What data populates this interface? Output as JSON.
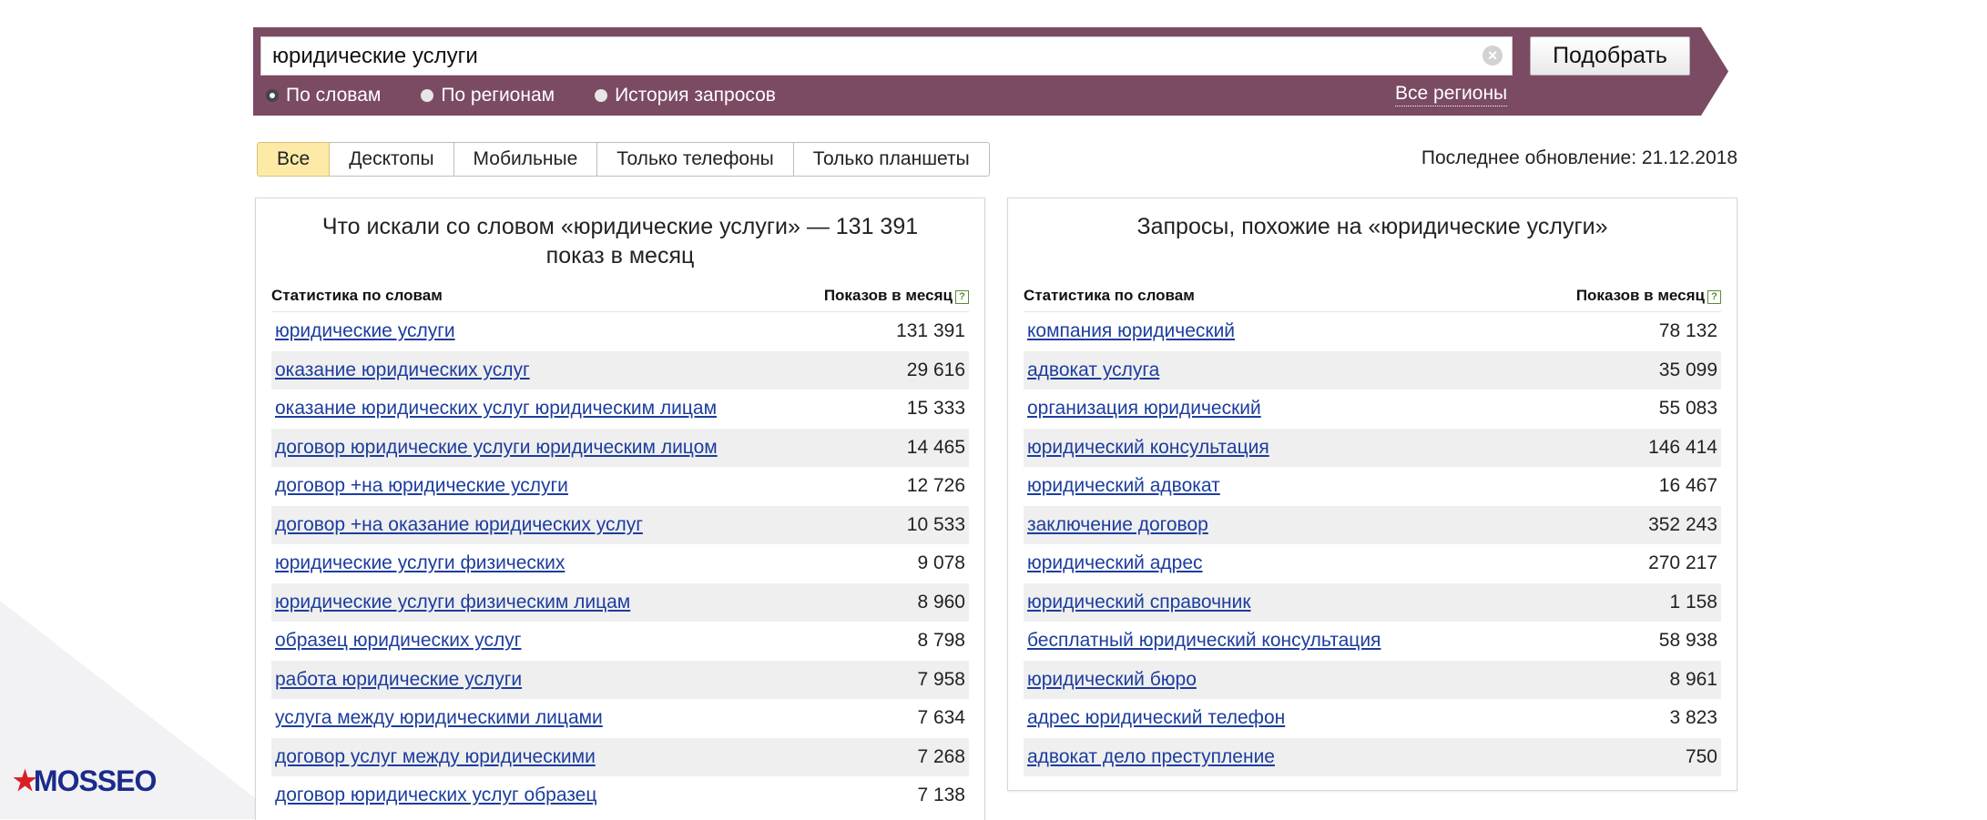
{
  "search": {
    "query": "юридические услуги",
    "submit_label": "Подобрать",
    "modes": [
      {
        "label": "По словам",
        "checked": true
      },
      {
        "label": "По регионам",
        "checked": false
      },
      {
        "label": "История запросов",
        "checked": false
      }
    ],
    "regions_label": "Все регионы"
  },
  "tabs": [
    {
      "label": "Все",
      "active": true
    },
    {
      "label": "Десктопы",
      "active": false
    },
    {
      "label": "Мобильные",
      "active": false
    },
    {
      "label": "Только телефоны",
      "active": false
    },
    {
      "label": "Только планшеты",
      "active": false
    }
  ],
  "last_update": "Последнее обновление: 21.12.2018",
  "left_panel": {
    "title": "Что искали со словом «юридические услуги» — 131 391 показ в месяц",
    "col_keyword": "Статистика по словам",
    "col_count": "Показов в месяц",
    "rows": [
      {
        "keyword": "юридические услуги",
        "count": "131 391"
      },
      {
        "keyword": "оказание юридических услуг",
        "count": "29 616"
      },
      {
        "keyword": "оказание юридических услуг юридическим лицам",
        "count": "15 333"
      },
      {
        "keyword": "договор юридические услуги юридическим лицом",
        "count": "14 465"
      },
      {
        "keyword": "договор +на юридические услуги",
        "count": "12 726"
      },
      {
        "keyword": "договор +на оказание юридических услуг",
        "count": "10 533"
      },
      {
        "keyword": "юридические услуги физических",
        "count": "9 078"
      },
      {
        "keyword": "юридические услуги физическим лицам",
        "count": "8 960"
      },
      {
        "keyword": "образец юридических услуг",
        "count": "8 798"
      },
      {
        "keyword": "работа юридические услуги",
        "count": "7 958"
      },
      {
        "keyword": "услуга между юридическими лицами",
        "count": "7 634"
      },
      {
        "keyword": "договор услуг между юридическими",
        "count": "7 268"
      },
      {
        "keyword": "договор юридических услуг образец",
        "count": "7 138"
      }
    ]
  },
  "right_panel": {
    "title": "Запросы, похожие на «юридические услуги»",
    "col_keyword": "Статистика по словам",
    "col_count": "Показов в месяц",
    "rows": [
      {
        "keyword": "компания юридический",
        "count": "78 132"
      },
      {
        "keyword": "адвокат услуга",
        "count": "35 099"
      },
      {
        "keyword": "организация юридический",
        "count": "55 083"
      },
      {
        "keyword": "юридический консультация",
        "count": "146 414"
      },
      {
        "keyword": "юридический адвокат",
        "count": "16 467"
      },
      {
        "keyword": "заключение договор",
        "count": "352 243"
      },
      {
        "keyword": "юридический адрес",
        "count": "270 217"
      },
      {
        "keyword": "юридический справочник",
        "count": "1 158"
      },
      {
        "keyword": "бесплатный юридический консультация",
        "count": "58 938"
      },
      {
        "keyword": "юридический бюро",
        "count": "8 961"
      },
      {
        "keyword": "адрес юридический телефон",
        "count": "3 823"
      },
      {
        "keyword": "адвокат дело преступление",
        "count": "750"
      }
    ]
  },
  "logo": {
    "text": "MOSSEO",
    "icon": "star-icon"
  },
  "colors": {
    "band": "#7b4a63",
    "link": "#1c3d9e",
    "active_tab": "#fdeaa7"
  }
}
